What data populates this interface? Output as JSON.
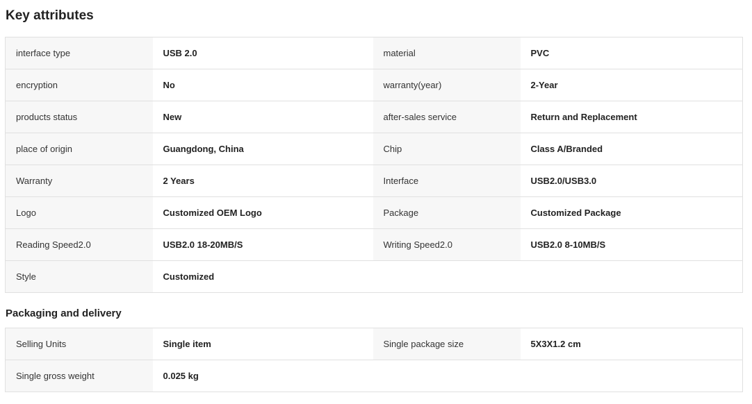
{
  "key_attributes": {
    "title": "Key attributes",
    "rows": [
      [
        {
          "k": "interface type",
          "v": "USB 2.0"
        },
        {
          "k": "material",
          "v": "PVC"
        }
      ],
      [
        {
          "k": "encryption",
          "v": "No"
        },
        {
          "k": "warranty(year)",
          "v": "2-Year"
        }
      ],
      [
        {
          "k": "products status",
          "v": "New"
        },
        {
          "k": "after-sales service",
          "v": "Return and Replacement"
        }
      ],
      [
        {
          "k": "place of origin",
          "v": "Guangdong, China"
        },
        {
          "k": "Chip",
          "v": "Class A/Branded"
        }
      ],
      [
        {
          "k": "Warranty",
          "v": "2 Years"
        },
        {
          "k": "Interface",
          "v": "USB2.0/USB3.0"
        }
      ],
      [
        {
          "k": "Logo",
          "v": "Customized OEM Logo"
        },
        {
          "k": "Package",
          "v": "Customized Package"
        }
      ],
      [
        {
          "k": "Reading Speed2.0",
          "v": "USB2.0 18-20MB/S"
        },
        {
          "k": "Writing Speed2.0",
          "v": "USB2.0 8-10MB/S"
        }
      ],
      [
        {
          "k": "Style",
          "v": "Customized"
        }
      ]
    ]
  },
  "packaging": {
    "title": "Packaging and delivery",
    "rows": [
      [
        {
          "k": "Selling Units",
          "v": "Single item"
        },
        {
          "k": "Single package size",
          "v": "5X3X1.2 cm"
        }
      ],
      [
        {
          "k": "Single gross weight",
          "v": "0.025 kg"
        }
      ]
    ]
  },
  "colors": {
    "key_cell_bg": "#f7f7f7",
    "border": "#e0e0e0",
    "text": "#222222"
  }
}
